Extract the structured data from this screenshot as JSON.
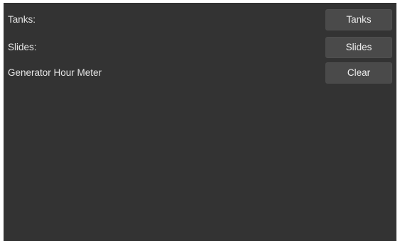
{
  "rows": [
    {
      "label": "Tanks:",
      "button_label": "Tanks"
    },
    {
      "label": "Slides:",
      "button_label": "Slides"
    },
    {
      "label": "Generator Hour Meter",
      "button_label": "Clear"
    }
  ],
  "colors": {
    "background": "#333333",
    "button": "#4a4a4a",
    "text": "#e6e6e6"
  }
}
